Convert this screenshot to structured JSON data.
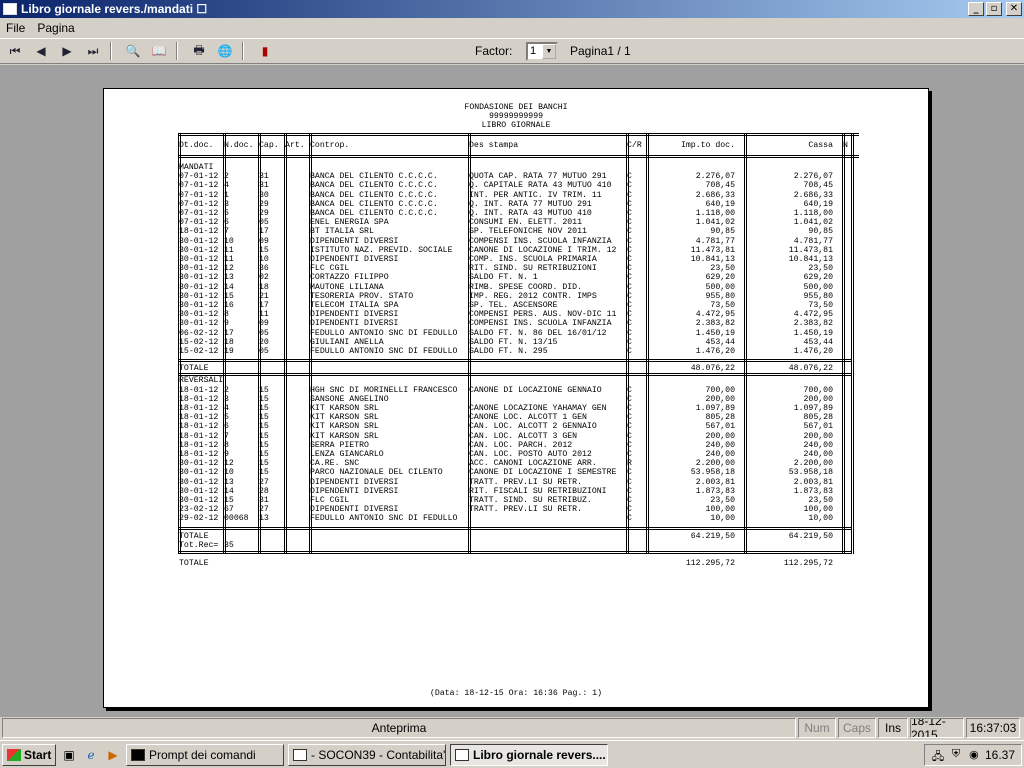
{
  "window": {
    "title": "Libro giornale revers./mandati ☐",
    "min": "_",
    "max": "▫",
    "close": "✕"
  },
  "menu": [
    {
      "label": "File"
    },
    {
      "label": "Pagina"
    }
  ],
  "toolbar": {
    "first_icon": "⏮",
    "prev_icon": "◀",
    "next_icon": "▶",
    "last_icon": "⏭",
    "search_icon": "🔍",
    "book_icon": "📖",
    "print_icon": "🖶",
    "export_icon": "🌐",
    "exit_icon": "▮",
    "factor_label": "Factor:",
    "factor_value": "1",
    "page_label": "Pagina1 / 1"
  },
  "report": {
    "org": "FONDASIONE DEI BANCHI",
    "code": "99999999999",
    "title": "LIBRO GIORNALE",
    "columns": [
      "Dt.doc.",
      "N.doc.",
      "Cap.",
      "Art.",
      "Controp.",
      "Des stampa",
      "C/R",
      "Imp.to doc.",
      "Cassa",
      "N"
    ],
    "section_mandati": "MANDATI",
    "mandati": [
      [
        "07-01-12",
        "2",
        "31",
        "BANCA DEL CILENTO C.C.C.C.",
        "QUOTA CAP. RATA 77 MUTUO 291",
        "C",
        "2.276,07",
        "2.276,07"
      ],
      [
        "07-01-12",
        "4",
        "31",
        "BANCA DEL CILENTO C.C.C.C.",
        "Q. CAPITALE RATA 43 MUTUO 410",
        "C",
        "708,45",
        "708,45"
      ],
      [
        "07-01-12",
        "1",
        "30",
        "BANCA DEL CILENTO C.C.C.C.",
        "INT. PER ANTIC. IV TRIM. 11",
        "C",
        "2.686,33",
        "2.686,33"
      ],
      [
        "07-01-12",
        "3",
        "29",
        "BANCA DEL CILENTO C.C.C.C.",
        "Q. INT. RATA 77 MUTUO 291",
        "C",
        "640,19",
        "640,19"
      ],
      [
        "07-01-12",
        "5",
        "29",
        "BANCA DEL CILENTO C.C.C.C.",
        "Q. INT. RATA 43 MUTUO 410",
        "C",
        "1.118,00",
        "1.118,00"
      ],
      [
        "07-01-12",
        "6",
        "05",
        "ENEL ENERGIA SPA",
        "CONSUMI EN. ELETT. 2011",
        "C",
        "1.041,02",
        "1.041,02"
      ],
      [
        "18-01-12",
        "7",
        "17",
        "BT ITALIA SRL",
        "SP. TELEFONICHE NOV 2011",
        "C",
        "90,85",
        "90,85"
      ],
      [
        "30-01-12",
        "10",
        "09",
        "DIPENDENTI DIVERSI",
        "COMPENSI INS. SCUOLA INFANZIA",
        "C",
        "4.781,77",
        "4.781,77"
      ],
      [
        "30-01-12",
        "11",
        "15",
        "ISTITUTO NAZ. PREVID. SOCIALE",
        "CANONE DI LOCAZIONE I TRIM. 12",
        "C",
        "11.473,81",
        "11.473,81"
      ],
      [
        "30-01-12",
        "11",
        "10",
        "DIPENDENTI DIVERSI",
        "COMP. INS. SCUOLA PRIMARIA",
        "C",
        "10.841,13",
        "10.841,13"
      ],
      [
        "30-01-12",
        "12",
        "36",
        "FLC CGIL",
        "RIT. SIND. SU RETRIBUZIONI",
        "C",
        "23,50",
        "23,50"
      ],
      [
        "30-01-12",
        "13",
        "02",
        "CORTAZZO FILIPPO",
        "SALDO FT. N. 1",
        "C",
        "629,20",
        "629,20"
      ],
      [
        "30-01-12",
        "14",
        "18",
        "MAUTONE LILIANA",
        "RIMB. SPESE COORD. DID.",
        "C",
        "500,00",
        "500,00"
      ],
      [
        "30-01-12",
        "15",
        "21",
        "TESORERIA PROV. STATO",
        "IMP. REG. 2012 CONTR. IMPS",
        "C",
        "955,80",
        "955,80"
      ],
      [
        "30-01-12",
        "16",
        "17",
        "TELECOM ITALIA SPA",
        "SP. TEL. ASCENSORE",
        "C",
        "73,50",
        "73,50"
      ],
      [
        "30-01-12",
        "8",
        "11",
        "DIPENDENTI DIVERSI",
        "COMPENSI PERS. AUS. NOV-DIC 11",
        "C",
        "4.472,95",
        "4.472,95"
      ],
      [
        "30-01-12",
        "9",
        "09",
        "DIPENDENTI DIVERSI",
        "COMPENSI INS. SCUOLA INFANZIA",
        "C",
        "2.383,82",
        "2.383,82"
      ],
      [
        "06-02-12",
        "17",
        "05",
        "FEDULLO ANTONIO SNC DI FEDULLO",
        "SALDO FT. N. 86 DEL 16/01/12",
        "C",
        "1.450,19",
        "1.450,19"
      ],
      [
        "15-02-12",
        "18",
        "20",
        "GIULIANI ANELLA",
        "SALDO FT. N. 13/15",
        "C",
        "453,44",
        "453,44"
      ],
      [
        "15-02-12",
        "19",
        "05",
        "FEDULLO ANTONIO SNC DI FEDULLO",
        "SALDO FT. N. 295",
        "C",
        "1.476,20",
        "1.476,20"
      ]
    ],
    "totale_mandati_label": "TOTALE",
    "totale_mandati": [
      "48.076,22",
      "48.076,22"
    ],
    "section_reversali": "REVERSALI",
    "reversali": [
      [
        "18-01-12",
        "2",
        "15",
        "HGH SNC DI MORINELLI FRANCESCO",
        "CANONE DI LOCAZIONE GENNAIO",
        "C",
        "700,00",
        "700,00"
      ],
      [
        "18-01-12",
        "3",
        "15",
        "SANSONE ANGELINO",
        "",
        "C",
        "200,00",
        "200,00"
      ],
      [
        "18-01-12",
        "4",
        "15",
        "KIT KARSON SRL",
        "CANONE LOCAZIONE YAHAMAY GEN",
        "C",
        "1.097,89",
        "1.097,89"
      ],
      [
        "18-01-12",
        "5",
        "15",
        "KIT KARSON SRL",
        "CANONE LOC. ALCOTT 1 GEN",
        "C",
        "805,28",
        "805,28"
      ],
      [
        "18-01-12",
        "6",
        "15",
        "KIT KARSON SRL",
        "CAN. LOC. ALCOTT 2 GENNAIO",
        "C",
        "567,01",
        "567,01"
      ],
      [
        "18-01-12",
        "7",
        "15",
        "KIT KARSON SRL",
        "CAN. LOC. ALCOTT 3 GEN",
        "C",
        "200,00",
        "200,00"
      ],
      [
        "18-01-12",
        "8",
        "15",
        "SERRA PIETRO",
        "CAN. LOC. PARCH. 2012",
        "C",
        "240,00",
        "240,00"
      ],
      [
        "18-01-12",
        "9",
        "15",
        "LENZA GIANCARLO",
        "CAN. LOC. POSTO AUTO 2012",
        "C",
        "240,00",
        "240,00"
      ],
      [
        "30-01-12",
        "12",
        "15",
        "CA.RE. SNC",
        "ACC. CANONI LOCAZIONE ARR.",
        "R",
        "2.200,00",
        "2.200,00"
      ],
      [
        "30-01-12",
        "10",
        "15",
        "PARCO NAZIONALE DEL CILENTO",
        "CANONE DI LOCAZIONE I SEMESTRE",
        "C",
        "53.958,18",
        "53.958,18"
      ],
      [
        "30-01-12",
        "13",
        "27",
        "DIPENDENTI DIVERSI",
        "TRATT. PREV.LI SU RETR.",
        "C",
        "2.003,81",
        "2.003,81"
      ],
      [
        "30-01-12",
        "14",
        "28",
        "DIPENDENTI DIVERSI",
        "RIT. FISCALI SU RETRIBUZIONI",
        "C",
        "1.873,83",
        "1.873,83"
      ],
      [
        "30-01-12",
        "15",
        "31",
        "FLC CGIL",
        "TRATT. SIND. SU RETRIBUZ.",
        "C",
        "23,50",
        "23,50"
      ],
      [
        "23-02-12",
        "67",
        "27",
        "DIPENDENTI DIVERSI",
        "TRATT. PREV.LI SU RETR.",
        "C",
        "100,00",
        "100,00"
      ],
      [
        "29-02-12",
        "00068",
        "13",
        "FEDULLO ANTONIO SNC DI FEDULLO",
        "",
        "C",
        "10,00",
        "10,00"
      ]
    ],
    "totale_reversali_label": "TOTALE",
    "totale_reversali": [
      "64.219,50",
      "64.219,50"
    ],
    "tot_rec_label": "Tot.Rec=",
    "tot_rec_value": "35",
    "grand_total_label": "TOTALE",
    "grand_total": [
      "112.295,72",
      "112.295,72"
    ],
    "footer": "(Data: 18-12-15   Ora: 16:36  Pag.: 1)"
  },
  "status": {
    "main": "Anteprima",
    "num": "Num",
    "caps": "Caps",
    "ins": "Ins",
    "date": "18-12-2015",
    "time": "16:37:03"
  },
  "taskbar": {
    "start": "Start",
    "tasks": [
      {
        "label": "Prompt dei comandi",
        "active": false
      },
      {
        "label": "- SOCON39 - Contabilita'...",
        "active": false
      },
      {
        "label": "Libro giornale revers....",
        "active": true
      }
    ],
    "clock": "16.37"
  }
}
